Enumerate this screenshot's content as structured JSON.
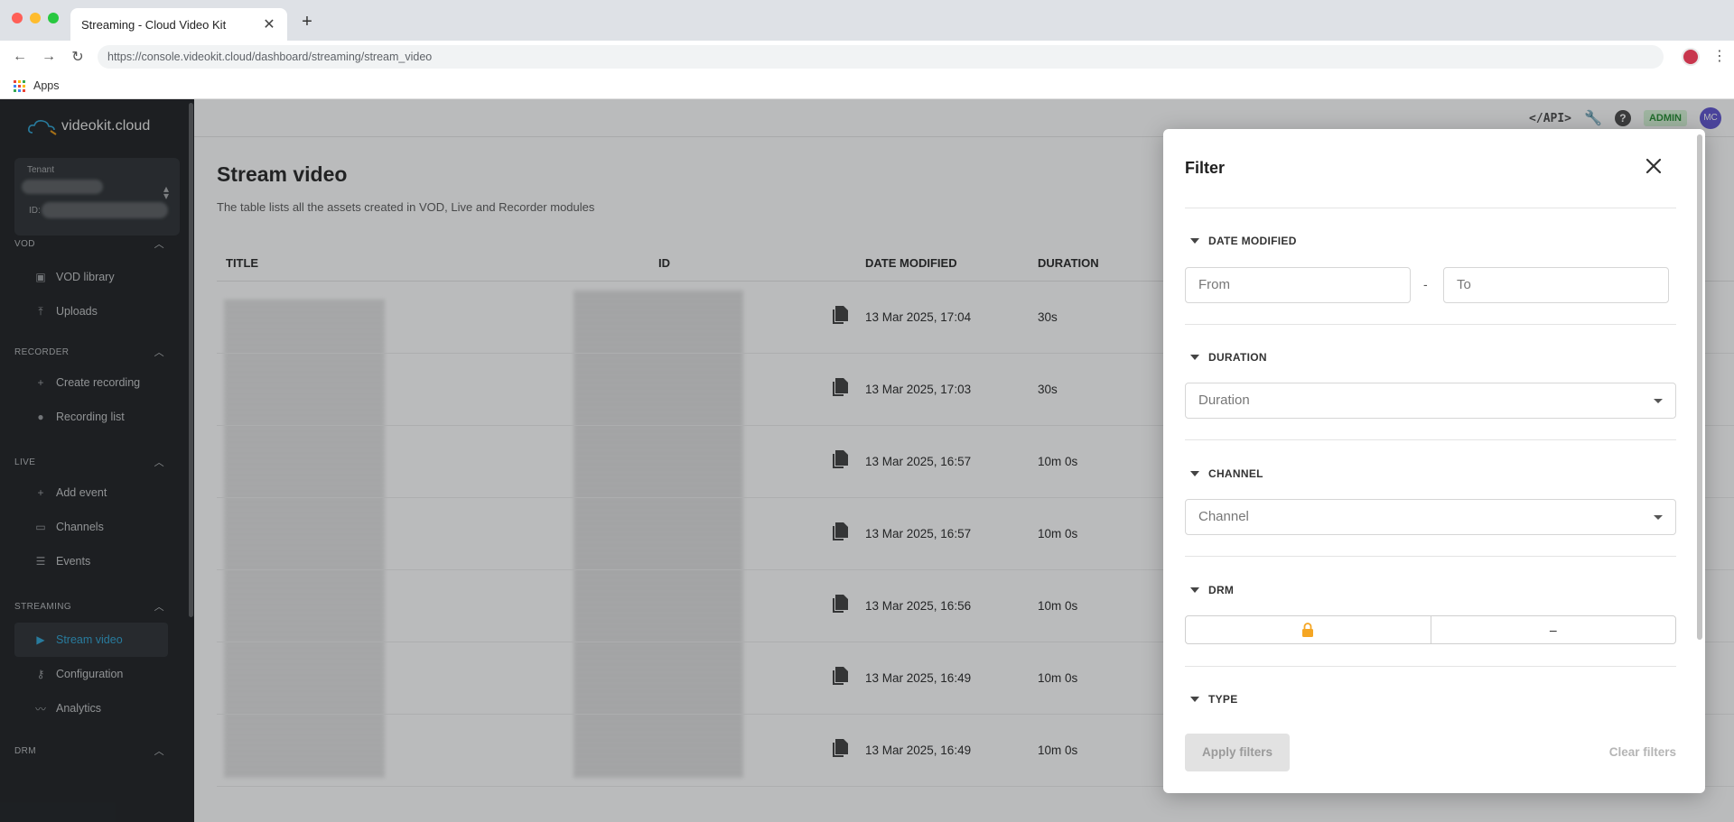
{
  "browser": {
    "tab_title": "Streaming - Cloud Video Kit",
    "url": "https://console.videokit.cloud/dashboard/streaming/stream_video",
    "bookmark_apps": "Apps"
  },
  "sidebar": {
    "logo": "videokit.cloud",
    "tenant_label": "Tenant",
    "tenant_id_label": "ID:",
    "sections": [
      {
        "title": "VOD",
        "items": [
          {
            "label": "VOD library",
            "icon": "library-icon"
          },
          {
            "label": "Uploads",
            "icon": "upload-icon"
          }
        ]
      },
      {
        "title": "RECORDER",
        "items": [
          {
            "label": "Create recording",
            "icon": "plus-icon"
          },
          {
            "label": "Recording list",
            "icon": "record-icon"
          }
        ]
      },
      {
        "title": "LIVE",
        "items": [
          {
            "label": "Add event",
            "icon": "plus-icon"
          },
          {
            "label": "Channels",
            "icon": "monitor-icon"
          },
          {
            "label": "Events",
            "icon": "list-icon"
          }
        ]
      },
      {
        "title": "STREAMING",
        "items": [
          {
            "label": "Stream video",
            "icon": "play-icon",
            "active": true
          },
          {
            "label": "Configuration",
            "icon": "key-icon"
          },
          {
            "label": "Analytics",
            "icon": "chart-icon"
          }
        ]
      },
      {
        "title": "DRM",
        "items": []
      }
    ]
  },
  "topbar": {
    "api_label": "</API>",
    "admin_label": "ADMIN",
    "avatar_initials": "MC"
  },
  "page": {
    "title": "Stream video",
    "subtitle": "The table lists all the assets created in VOD, Live and Recorder modules"
  },
  "table": {
    "headers": {
      "title": "TITLE",
      "id": "ID",
      "date": "DATE MODIFIED",
      "duration": "DURATION"
    },
    "rows": [
      {
        "date": "13 Mar 2025, 17:04",
        "duration": "30s"
      },
      {
        "date": "13 Mar 2025, 17:03",
        "duration": "30s"
      },
      {
        "date": "13 Mar 2025, 16:57",
        "duration": "10m 0s"
      },
      {
        "date": "13 Mar 2025, 16:57",
        "duration": "10m 0s"
      },
      {
        "date": "13 Mar 2025, 16:56",
        "duration": "10m 0s"
      },
      {
        "date": "13 Mar 2025, 16:49",
        "duration": "10m 0s"
      },
      {
        "date": "13 Mar 2025, 16:49",
        "duration": "10m 0s"
      }
    ]
  },
  "filter": {
    "title": "Filter",
    "date_modified": {
      "heading": "DATE MODIFIED",
      "from_placeholder": "From",
      "to_placeholder": "To",
      "separator": "-"
    },
    "duration": {
      "heading": "DURATION",
      "placeholder": "Duration"
    },
    "channel": {
      "heading": "CHANNEL",
      "placeholder": "Channel"
    },
    "drm": {
      "heading": "DRM",
      "off_label": "–"
    },
    "type": {
      "heading": "TYPE"
    },
    "apply_label": "Apply filters",
    "clear_label": "Clear filters"
  },
  "colors": {
    "accent": "#3bb5e8",
    "sidebar_bg": "#2b2f33",
    "admin_badge": "#1d8a2b",
    "lock": "#f5a623"
  }
}
